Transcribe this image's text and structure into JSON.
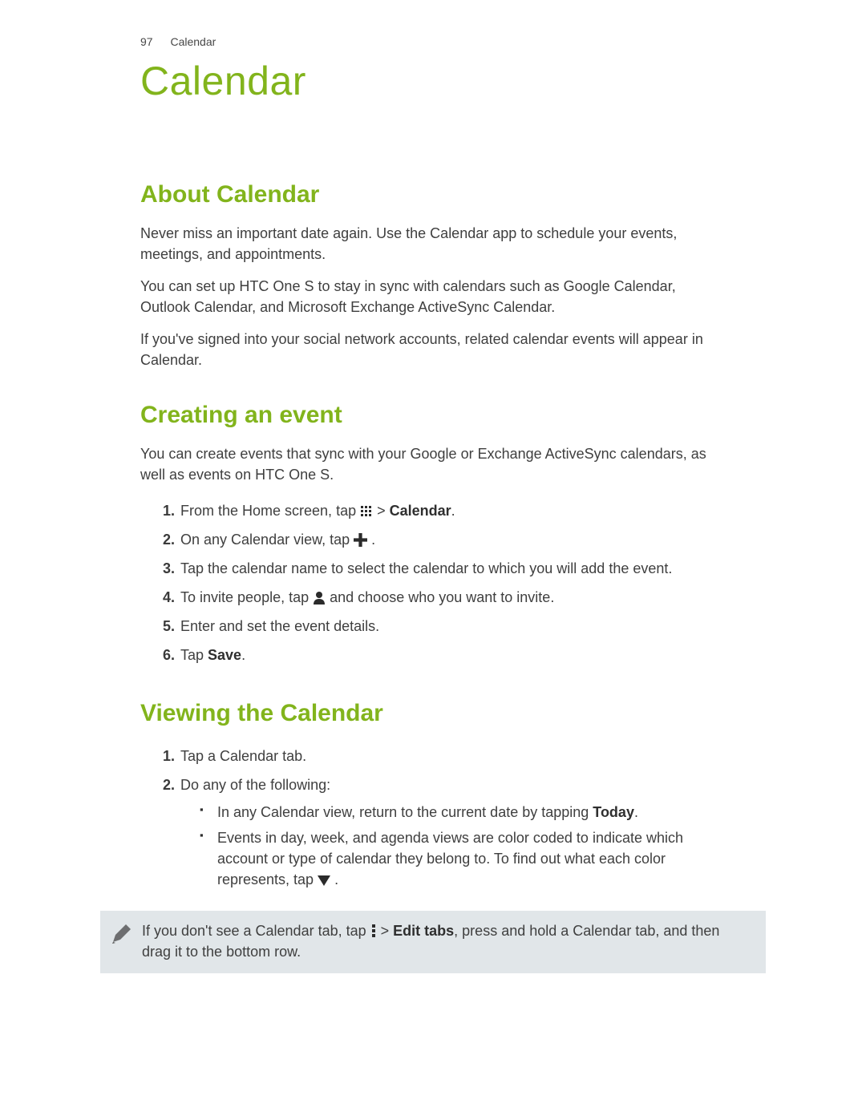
{
  "header": {
    "page_number": "97",
    "section_name": "Calendar"
  },
  "title": "Calendar",
  "sections": {
    "about": {
      "heading": "About Calendar",
      "p1": "Never miss an important date again. Use the Calendar app to schedule your events, meetings, and appointments.",
      "p2": "You can set up HTC One S to stay in sync with calendars such as Google Calendar, Outlook Calendar, and Microsoft Exchange ActiveSync Calendar.",
      "p3": "If you've signed into your social network accounts, related calendar events will appear in Calendar."
    },
    "creating": {
      "heading": "Creating an event",
      "intro": "You can create events that sync with your Google or Exchange ActiveSync calendars, as well as events on HTC One S.",
      "step1_a": "From the Home screen, tap ",
      "step1_b": " > ",
      "step1_c": "Calendar",
      "step1_d": ".",
      "step2_a": "On any Calendar view, tap ",
      "step2_b": ".",
      "step3": "Tap the calendar name to select the calendar to which you will add the event.",
      "step4_a": "To invite people, tap ",
      "step4_b": " and choose who you want to invite.",
      "step5": "Enter and set the event details.",
      "step6_a": "Tap ",
      "step6_b": "Save",
      "step6_c": "."
    },
    "viewing": {
      "heading": "Viewing the Calendar",
      "step1": "Tap a Calendar tab.",
      "step2": "Do any of the following:",
      "bul1_a": "In any Calendar view, return to the current date by tapping ",
      "bul1_b": "Today",
      "bul1_c": ".",
      "bul2_a": "Events in day, week, and agenda views are color coded to indicate which account or type of calendar they belong to. To find out what each color represents, tap ",
      "bul2_b": "."
    },
    "note": {
      "a": "If you don't see a Calendar tab, tap ",
      "b": " > ",
      "c": "Edit tabs",
      "d": ", press and hold a Calendar tab, and then drag it to the bottom row."
    }
  },
  "icons": {
    "apps_grid": "apps-grid-icon",
    "plus": "plus-icon",
    "person": "person-icon",
    "dropdown": "dropdown-triangle-icon",
    "more": "more-vertical-icon",
    "pencil": "pencil-icon"
  }
}
